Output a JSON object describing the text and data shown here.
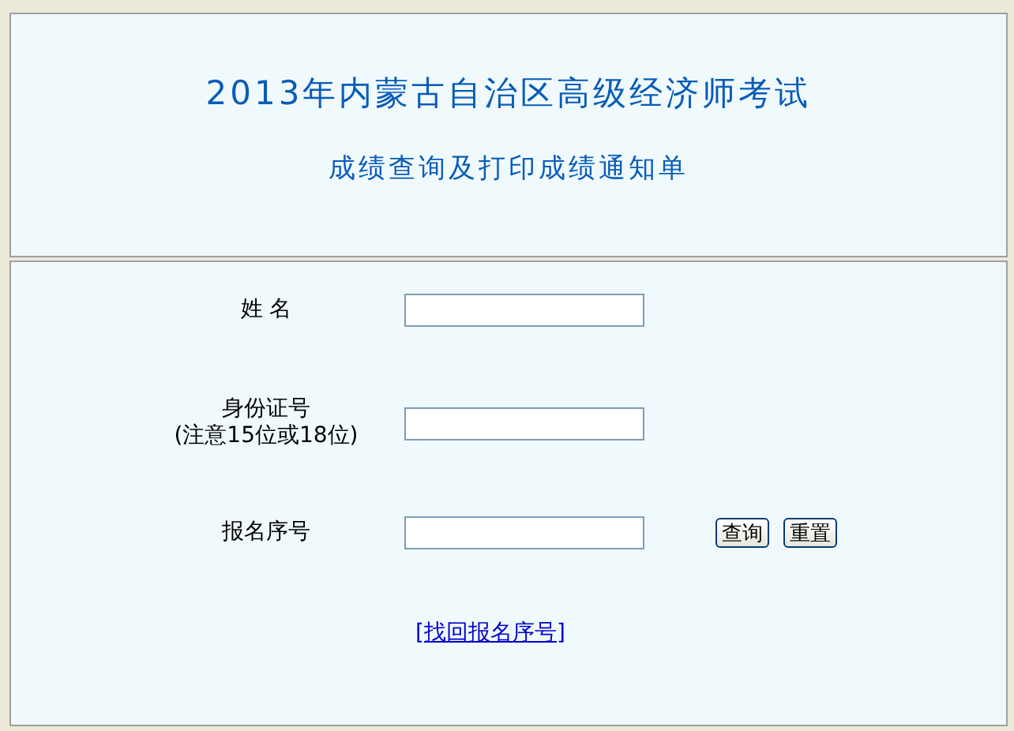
{
  "header": {
    "title": "2013年内蒙古自治区高级经济师考试",
    "subtitle": "成绩查询及打印成绩通知单"
  },
  "fields": [
    {
      "label": "姓 名"
    },
    {
      "label": "身份证号",
      "note": "(注意15位或18位)"
    },
    {
      "label": "报名序号"
    }
  ],
  "buttons": [
    "查询",
    "重置"
  ],
  "link": "[找回报名序号]"
}
